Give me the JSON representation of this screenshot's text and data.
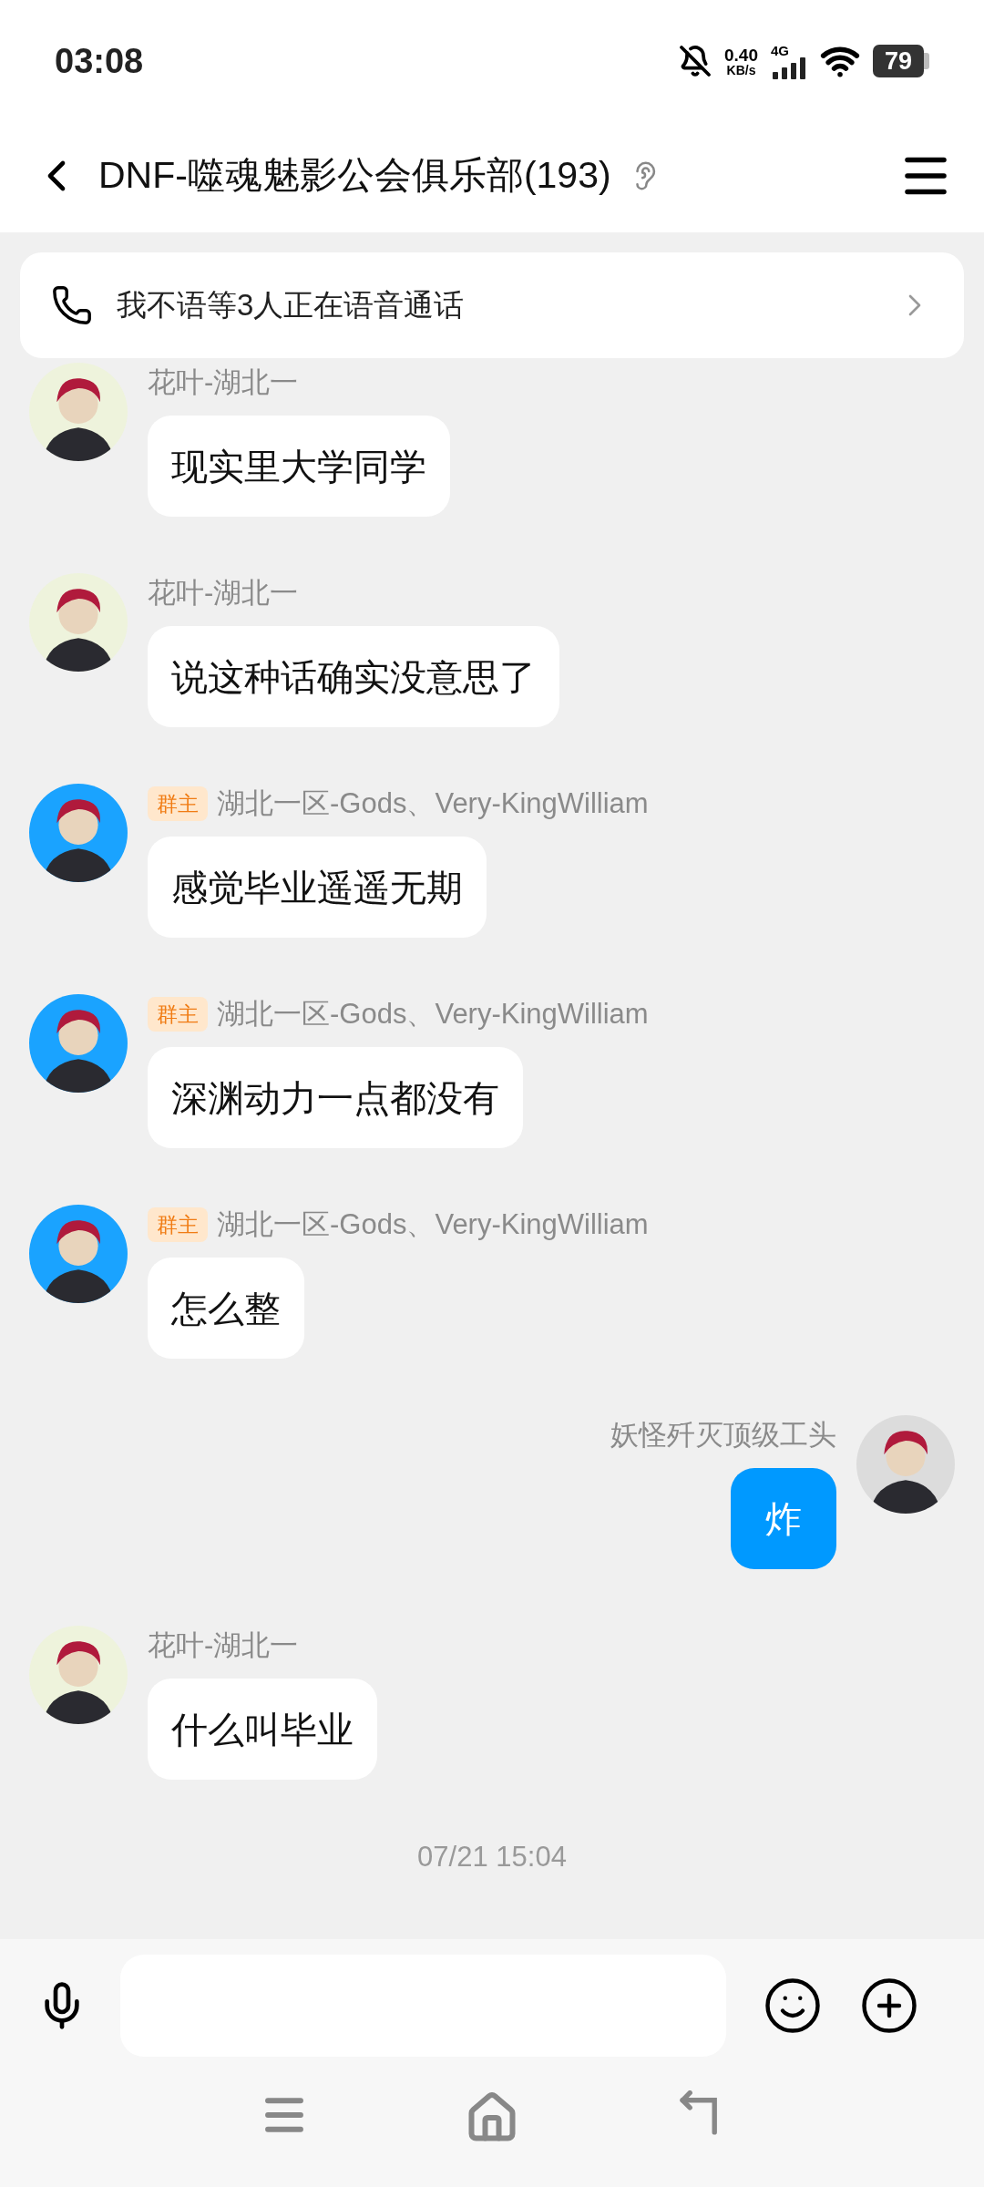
{
  "status_bar": {
    "time": "03:08",
    "speed_value": "0.40",
    "speed_unit": "KB/s",
    "network": "4G",
    "battery": "79"
  },
  "header": {
    "title": "DNF-噬魂魅影公会俱乐部(193)"
  },
  "voice_banner": {
    "text": "我不语等3人正在语音通话"
  },
  "messages": [
    {
      "kind": "peer",
      "color": "#eef3dc",
      "name": "花叶-湖北一",
      "text": "现实里大学同学"
    },
    {
      "kind": "peer",
      "color": "#eef3dc",
      "name": "花叶-湖北一",
      "text": "说这种话确实没意思了"
    },
    {
      "kind": "peer",
      "color": "#1aa3ff",
      "badge": "群主",
      "name": "湖北一区-Gods、Very-KingWilliam",
      "text": "感觉毕业遥遥无期"
    },
    {
      "kind": "peer",
      "color": "#1aa3ff",
      "badge": "群主",
      "name": "湖北一区-Gods、Very-KingWilliam",
      "text": "深渊动力一点都没有"
    },
    {
      "kind": "peer",
      "color": "#1aa3ff",
      "badge": "群主",
      "name": "湖北一区-Gods、Very-KingWilliam",
      "text": "怎么整"
    },
    {
      "kind": "self",
      "color": "#dcdcdc",
      "name": "妖怪歼灭顶级工头",
      "text": "炸"
    },
    {
      "kind": "peer",
      "color": "#eef3dc",
      "name": "花叶-湖北一",
      "text": "什么叫毕业"
    },
    {
      "kind": "timestamp",
      "text": "07/21 15:04"
    }
  ]
}
